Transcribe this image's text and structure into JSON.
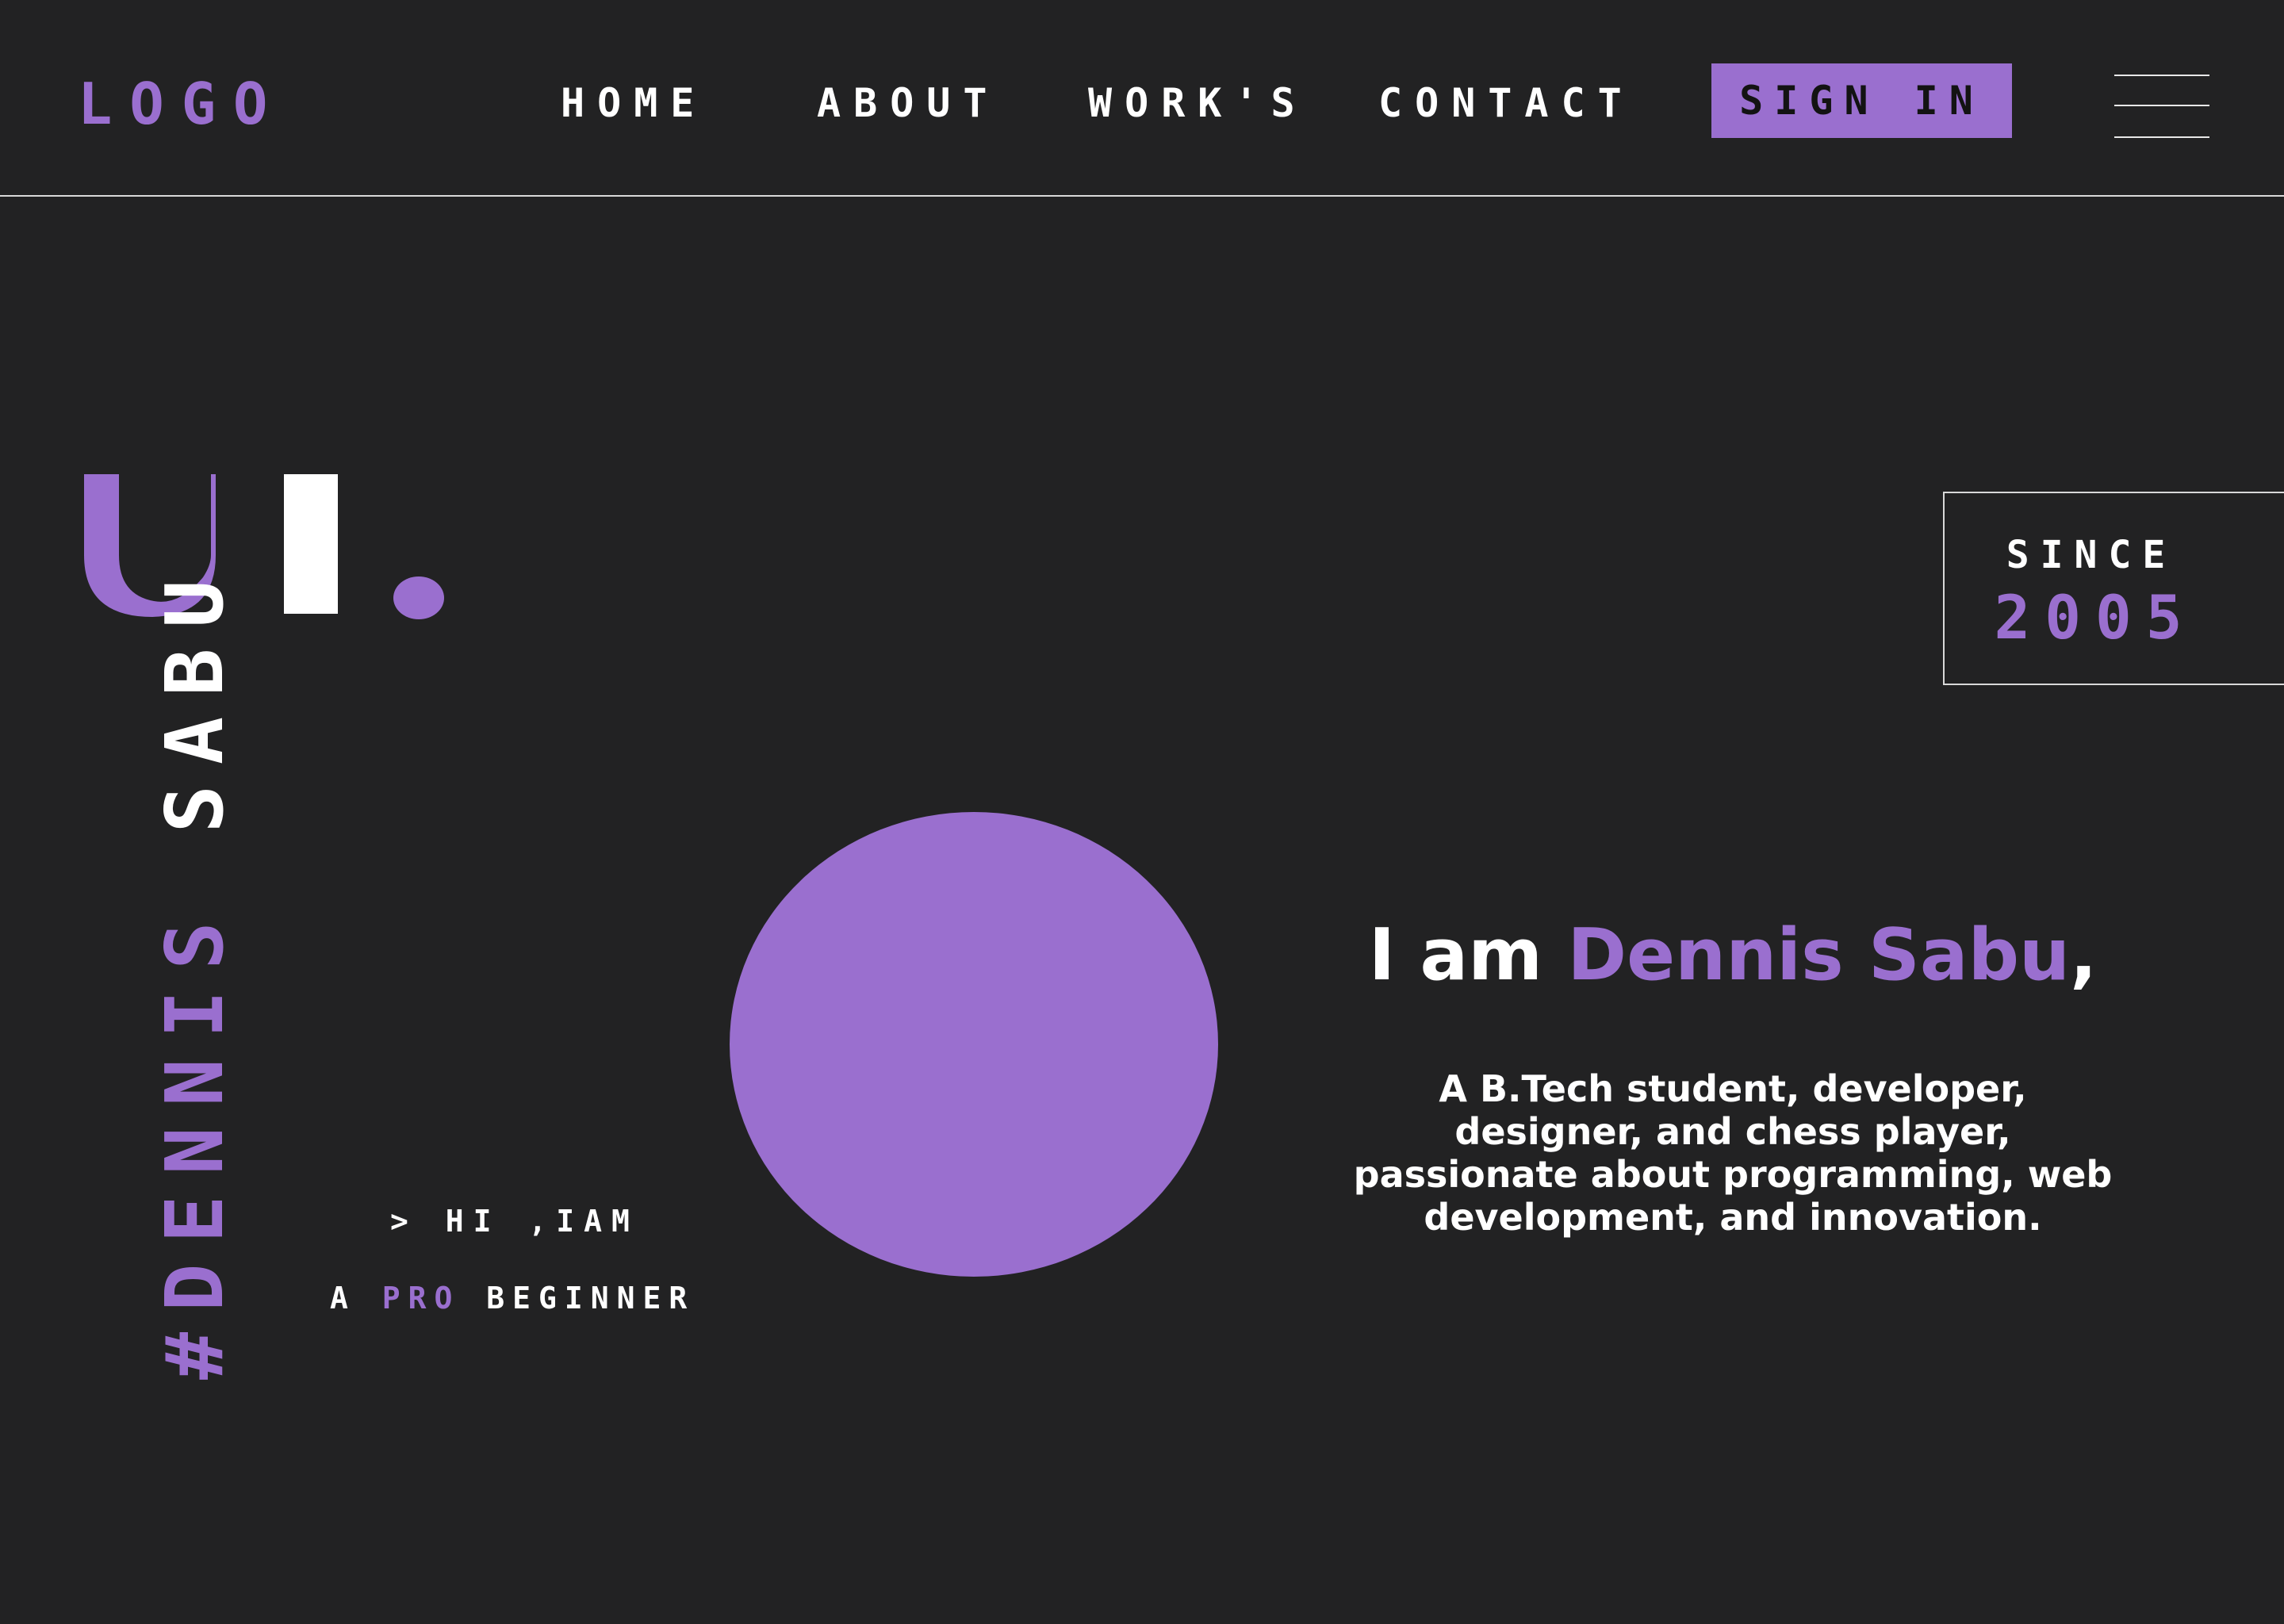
{
  "header": {
    "logo": "LOGO",
    "nav": {
      "home": "HOME",
      "about": "ABOUT",
      "works": "WORK'S",
      "contact": "CONTACT"
    },
    "sign_in": "SIGN IN"
  },
  "hero": {
    "ui_mark": {
      "u": "U",
      "i": "I",
      "dot": "."
    },
    "vertical_name": {
      "hash": "#",
      "first": "DENNIS",
      "last": "SABU"
    },
    "hi_line": "> HI ,IAM",
    "tagline": {
      "before": "A ",
      "accent": "PRO",
      "after": " BEGINNER"
    }
  },
  "since": {
    "label": "SINCE",
    "year": "2005"
  },
  "intro": {
    "prefix": "I am ",
    "name": "Dennis Sabu",
    "suffix": ",",
    "description": "A B.Tech student, developer, designer, and chess player, passionate about programming, web development, and innovation."
  },
  "colors": {
    "background": "#222223",
    "accent": "#9a6fcf",
    "text": "#ffffff",
    "divider": "#d9d9d9"
  },
  "icons": [
    "hamburger-menu-icon"
  ]
}
